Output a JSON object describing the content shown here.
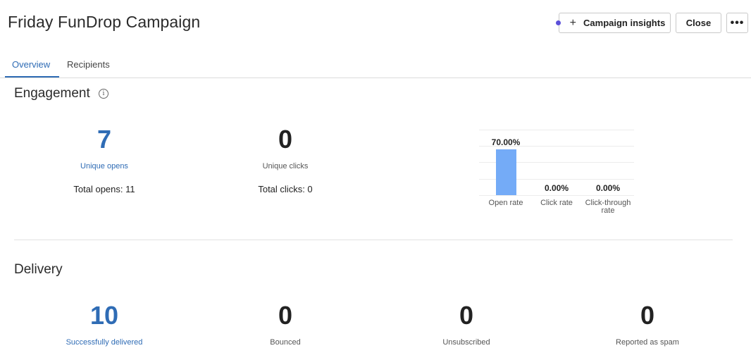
{
  "header": {
    "title": "Friday FunDrop Campaign",
    "insights_label": "Campaign insights",
    "close_label": "Close",
    "more_label": "•••"
  },
  "tabs": [
    {
      "label": "Overview",
      "active": true
    },
    {
      "label": "Recipients",
      "active": false
    }
  ],
  "engagement": {
    "title": "Engagement",
    "info_glyph": "i",
    "unique_opens": {
      "value": "7",
      "label": "Unique opens",
      "total": "Total opens: 11"
    },
    "unique_clicks": {
      "value": "0",
      "label": "Unique clicks",
      "total": "Total clicks: 0"
    }
  },
  "delivery": {
    "title": "Delivery",
    "metrics": [
      {
        "value": "10",
        "label": "Successfully delivered"
      },
      {
        "value": "0",
        "label": "Bounced"
      },
      {
        "value": "0",
        "label": "Unsubscribed"
      },
      {
        "value": "0",
        "label": "Reported as spam"
      }
    ]
  },
  "colors": {
    "accent": "#2f6cb5",
    "bar": "#74abf7",
    "insights_dot": "#5b4fd9"
  },
  "chart_data": {
    "type": "bar",
    "categories": [
      "Open rate",
      "Click rate",
      "Click-through rate"
    ],
    "values": [
      70,
      0,
      0
    ],
    "value_labels": [
      "70.00%",
      "0.00%",
      "0.00%"
    ],
    "ylim": [
      0,
      100
    ],
    "grid": true
  }
}
